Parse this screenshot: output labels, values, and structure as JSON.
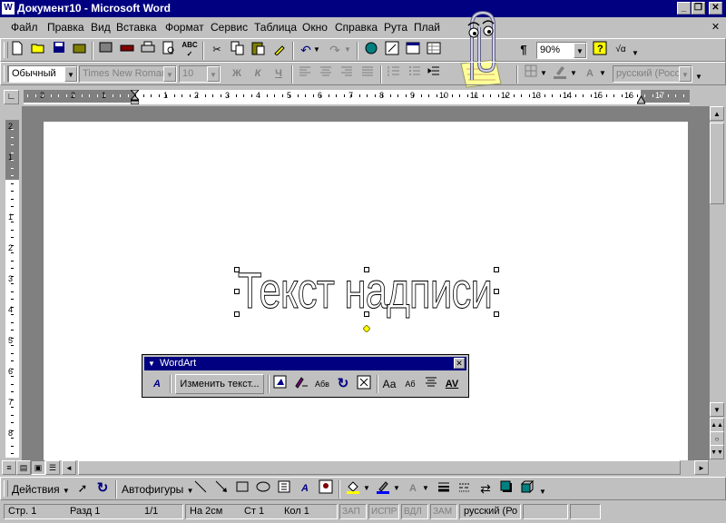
{
  "window": {
    "title": "Документ10 - Microsoft Word",
    "minimize": "_",
    "restore": "❐",
    "close": "✕"
  },
  "menu": [
    "Файл",
    "Правка",
    "Вид",
    "Вставка",
    "Формат",
    "Сервис",
    "Таблица",
    "Окно",
    "Справка",
    "Рута",
    "Плай"
  ],
  "standard_toolbar": {
    "zoom": "90%"
  },
  "formatting_toolbar": {
    "style": "Обычный",
    "font": "Times New Roman",
    "size": "10",
    "bold": "Ж",
    "italic": "К",
    "underline": "Ч",
    "language": "русский (Росс"
  },
  "ruler": {
    "numbers": [
      "3",
      "2",
      "1",
      "1",
      "2",
      "3",
      "4",
      "5",
      "6",
      "7",
      "8",
      "9",
      "10",
      "11",
      "12",
      "13",
      "14",
      "15",
      "16",
      "17"
    ],
    "vnumbers": [
      "2",
      "1",
      "1",
      "2",
      "3",
      "4",
      "5",
      "6",
      "7",
      "8"
    ]
  },
  "document": {
    "wordart_text": "Текст надписи"
  },
  "wordart_toolbar": {
    "title": "WordArt",
    "edit_text": "Изменить текст...",
    "same_letter_heights": "Аа",
    "vertical_text": "Аб",
    "spacing": "AV",
    "gallery": "Абв"
  },
  "drawing_toolbar": {
    "actions": "Действия",
    "autoshapes": "Автофигуры",
    "text_glyph": "A"
  },
  "status": {
    "page": "Стр. 1",
    "section": "Разд 1",
    "pages": "1/1",
    "at": "На 2см",
    "line": "Ст 1",
    "col": "Кол 1",
    "rec": "ЗАП",
    "trk": "ИСПР",
    "ext": "ВДЛ",
    "ovr": "ЗАМ",
    "lang": "русский (Ро"
  }
}
